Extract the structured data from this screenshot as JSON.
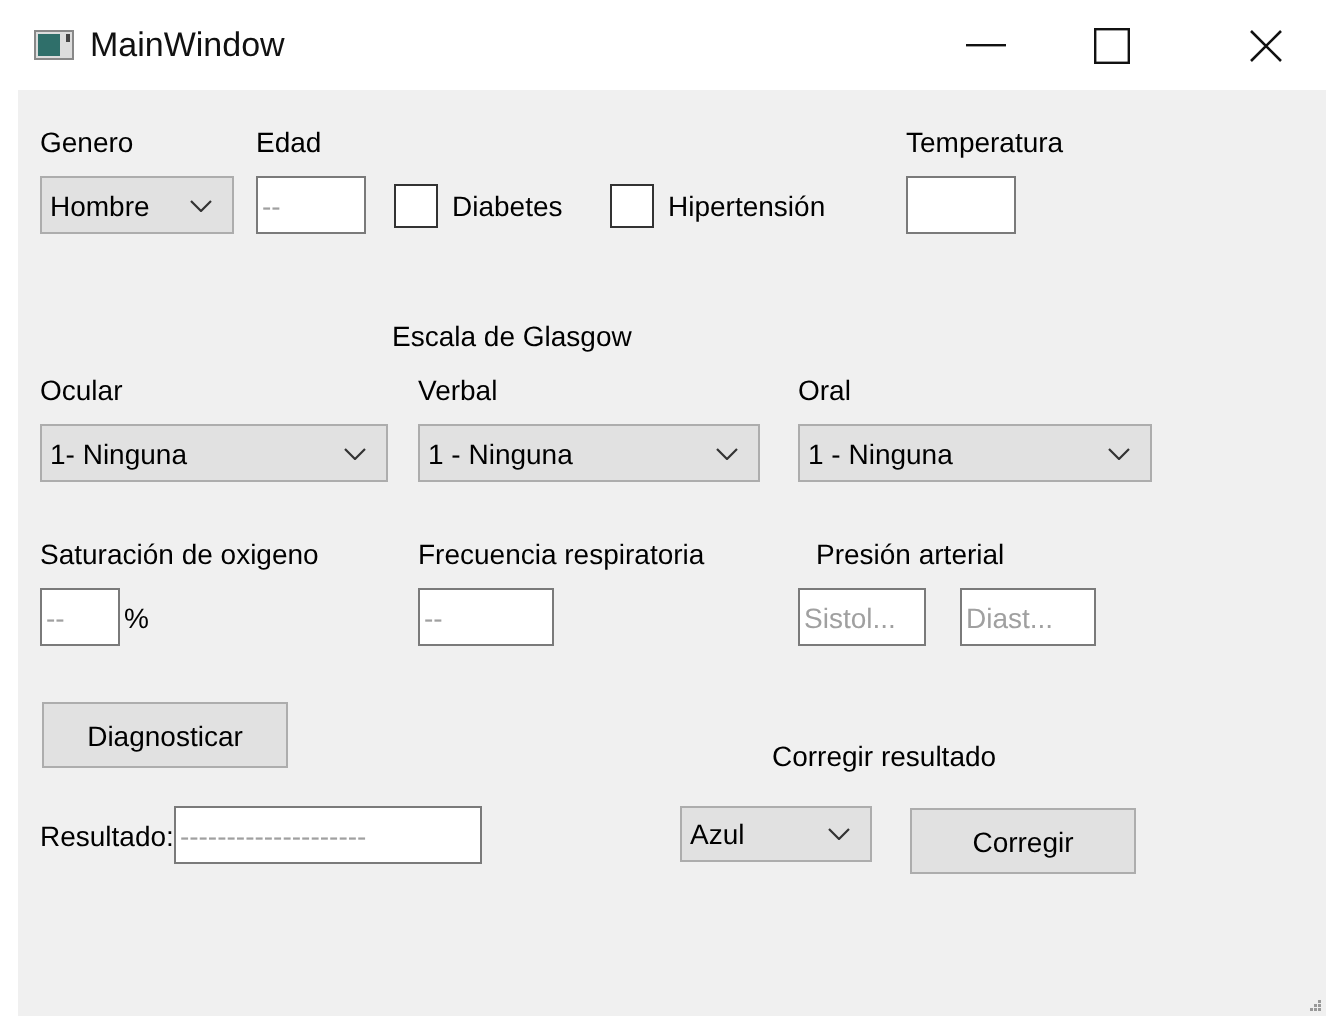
{
  "window": {
    "title": "MainWindow"
  },
  "patient": {
    "gender": {
      "label": "Genero",
      "value": "Hombre"
    },
    "age": {
      "label": "Edad",
      "placeholder": "--"
    },
    "conditions": [
      {
        "label": "Diabetes",
        "checked": false
      },
      {
        "label": "Hipertensión",
        "checked": false
      }
    ],
    "temperature": {
      "label": "Temperatura"
    }
  },
  "glasgow": {
    "title": "Escala de Glasgow",
    "scales": [
      {
        "label": "Ocular",
        "value": "1- Ninguna"
      },
      {
        "label": "Verbal",
        "value": "1 - Ninguna"
      },
      {
        "label": "Oral",
        "value": "1 - Ninguna"
      }
    ]
  },
  "vitals": {
    "saturation": {
      "label": "Saturación de oxigeno",
      "placeholder": "--",
      "unit": "%"
    },
    "respiratory_rate": {
      "label": "Frecuencia respiratoria",
      "placeholder": "--"
    },
    "blood_pressure": {
      "label": "Presión arterial",
      "systolic_placeholder": "Sistol...",
      "diastolic_placeholder": "Diast..."
    }
  },
  "diagnose_button": "Diagnosticar",
  "result": {
    "label": "Resultado:",
    "placeholder": "--------------------"
  },
  "correction": {
    "title": "Corregir resultado",
    "value": "Azul",
    "button": "Corregir"
  }
}
